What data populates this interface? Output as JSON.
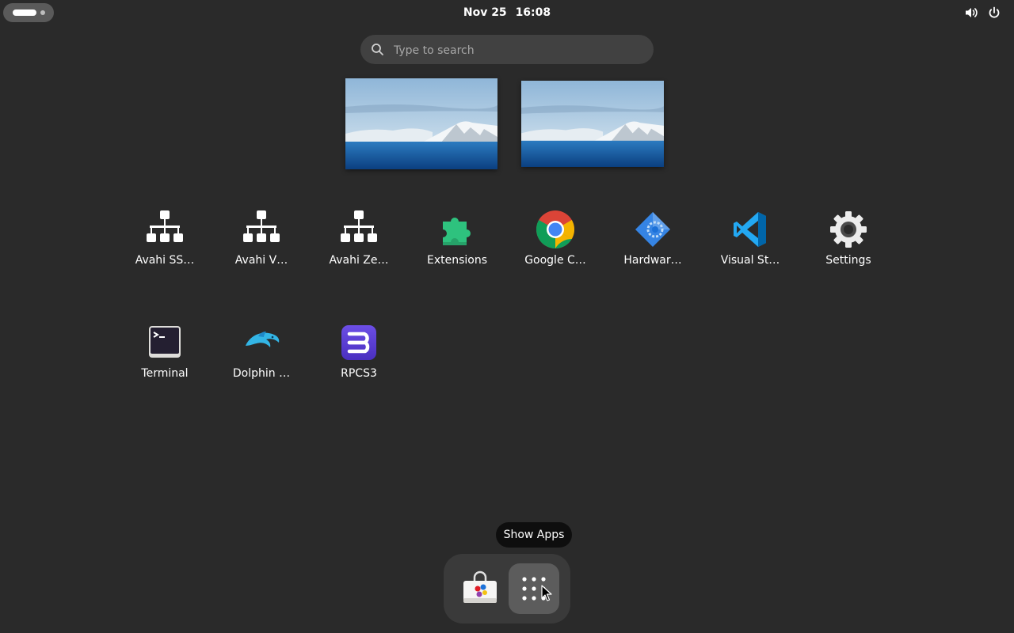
{
  "topbar": {
    "date": "Nov 25",
    "time": "16:08",
    "icons": [
      "activities-indicator",
      "volume-icon",
      "power-icon"
    ]
  },
  "search": {
    "placeholder": "Type to search",
    "value": ""
  },
  "workspaces": [
    {
      "name": "workspace-1",
      "wallpaper": "snowy-mountain-sea"
    },
    {
      "name": "workspace-2",
      "wallpaper": "snowy-mountain-sea"
    }
  ],
  "apps": [
    {
      "label": "Avahi SS…",
      "icon": "network-icon"
    },
    {
      "label": "Avahi V…",
      "icon": "network-icon"
    },
    {
      "label": "Avahi Ze…",
      "icon": "network-icon"
    },
    {
      "label": "Extensions",
      "icon": "puzzle-icon"
    },
    {
      "label": "Google C…",
      "icon": "chrome-icon"
    },
    {
      "label": "Hardwar…",
      "icon": "hardware-icon"
    },
    {
      "label": "Visual St…",
      "icon": "vscode-icon"
    },
    {
      "label": "Settings",
      "icon": "gear-icon"
    },
    {
      "label": "Terminal",
      "icon": "terminal-icon"
    },
    {
      "label": "Dolphin …",
      "icon": "dolphin-icon"
    },
    {
      "label": "RPCS3",
      "icon": "rpcs3-icon"
    }
  ],
  "dash": {
    "tooltip": "Show Apps",
    "items": [
      "software-icon",
      "show-apps-icon"
    ]
  },
  "colors": {
    "background": "#2a2a2a",
    "search_bg": "#414141",
    "dash_bg": "#3a3a3a",
    "extensions_green": "#2ec27e",
    "vscode_blue": "#23a8f2",
    "rpcs3_purple": "#5b3fd6"
  }
}
